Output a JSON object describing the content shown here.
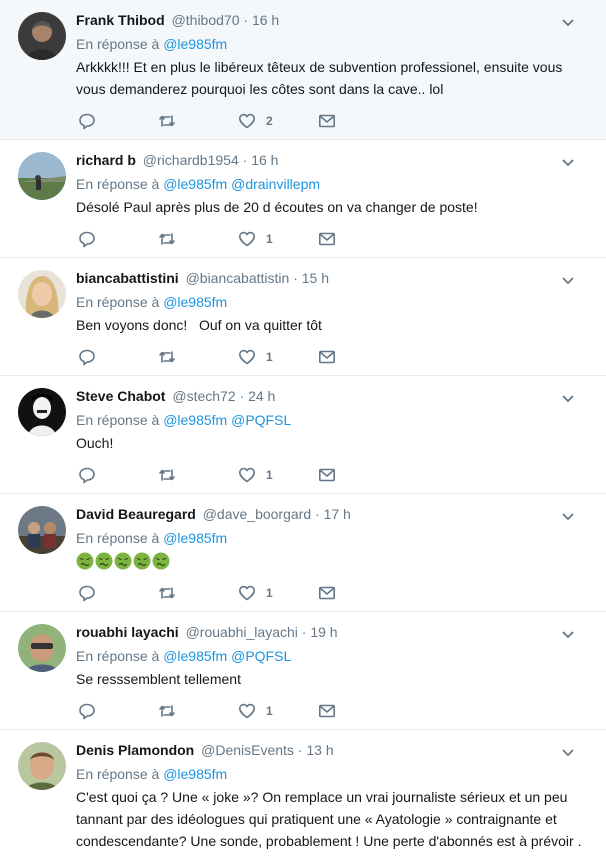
{
  "reply_prefix": "En réponse à",
  "tweets": [
    {
      "name": "Frank Thibod",
      "handle": "@thibod70",
      "sep": "·",
      "time": "16 h",
      "mentions": [
        "@le985fm"
      ],
      "text": "Arkkkk!!! Et en plus le libéreux têteux de subvention professionel, ensuite vous vous demanderez pourquoi les côtes sont dans la cave.. lol",
      "likes": "2",
      "highlight": true
    },
    {
      "name": "richard b",
      "handle": "@richardb1954",
      "sep": "·",
      "time": "16 h",
      "mentions": [
        "@le985fm",
        "@drainvillepm"
      ],
      "text": "Désolé Paul après plus de 20 d écoutes on va changer de poste!",
      "likes": "1"
    },
    {
      "name": "biancabattistini",
      "handle": "@biancabattistin",
      "sep": "·",
      "time": "15 h",
      "mentions": [
        "@le985fm"
      ],
      "text": "Ben voyons donc!   Ouf on va quitter tôt",
      "likes": "1"
    },
    {
      "name": "Steve Chabot",
      "handle": "@stech72",
      "sep": "·",
      "time": "24 h",
      "mentions": [
        "@le985fm",
        "@PQFSL"
      ],
      "text": "Ouch!",
      "likes": "1"
    },
    {
      "name": "David Beauregard",
      "handle": "@dave_boorgard",
      "sep": "·",
      "time": "17 h",
      "mentions": [
        "@le985fm"
      ],
      "text": "",
      "emoji_icon": "nauseated-face-emoji",
      "emoji_count": 5,
      "likes": "1"
    },
    {
      "name": "rouabhi layachi",
      "handle": "@rouabhi_layachi",
      "sep": "·",
      "time": "19 h",
      "mentions": [
        "@le985fm",
        "@PQFSL"
      ],
      "text": "Se resssemblent tellement",
      "likes": "1"
    },
    {
      "name": "Denis Plamondon",
      "handle": "@DenisEvents",
      "sep": "·",
      "time": "13 h",
      "mentions": [
        "@le985fm"
      ],
      "text": "C'est quoi ça ? Une « joke »? On remplace un vrai journaliste sérieux et un peu tannant par des idéologues  qui pratiquent une « Ayatologie » contraignante et condescendante? Une sonde, probablement ! Une perte d'abonnés est à prévoir .",
      "likes": ""
    }
  ],
  "colors": {
    "text": "#14171a",
    "secondary": "#657786",
    "link": "#1b95e0",
    "highlight_bg": "#f5f8fa",
    "border": "#e6ecf0"
  },
  "icons": [
    "reply-icon",
    "retweet-icon",
    "like-icon",
    "direct-message-icon",
    "chevron-down-icon"
  ]
}
